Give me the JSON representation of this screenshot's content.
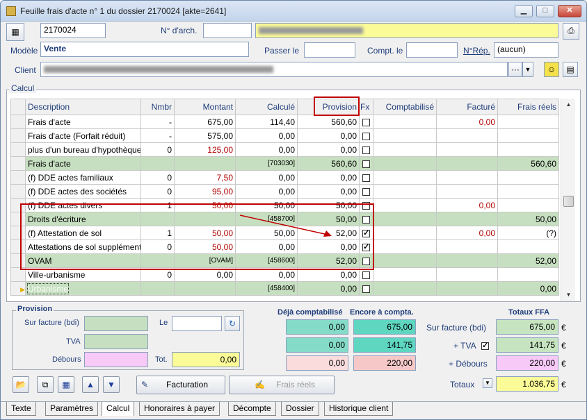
{
  "window": {
    "title": "Feuille frais d'acte n° 1 du dossier 2170024 [akte=2641]"
  },
  "header": {
    "dossier_value": "2170024",
    "narch_label": "N° d'arch.",
    "narch_value": "",
    "modele_label": "Modèle",
    "modele_value": "Vente",
    "passer_label": "Passer le",
    "passer_value": "",
    "compt_label": "Compt. le",
    "compt_value": "",
    "nrep_label": "N°Rép.",
    "nrep_value": "(aucun)",
    "client_label": "Client",
    "ellipsis": "···"
  },
  "calc": {
    "group_label": "Calcul",
    "columns": [
      "Description",
      "Nmbr",
      "Montant",
      "Calculé",
      "Provision",
      "Fx",
      "Comptabilisé",
      "Facturé",
      "Frais réels"
    ],
    "rows": [
      {
        "type": "item",
        "desc": "Frais d'acte",
        "nmbr": "-",
        "montant": "675,00",
        "calcule": "114,40",
        "provision": "560,60",
        "fx": false,
        "compt": "",
        "facture": "0,00",
        "frais": "",
        "montant_red": false,
        "facture_red": true
      },
      {
        "type": "item",
        "desc": "Frais d'acte (Forfait réduit)",
        "nmbr": "-",
        "montant": "575,00",
        "calcule": "0,00",
        "provision": "0,00",
        "fx": false,
        "compt": "",
        "facture": "",
        "frais": "",
        "montant_red": false
      },
      {
        "type": "item",
        "desc": "plus d'un bureau d'hypothèques",
        "nmbr": "0",
        "montant": "125,00",
        "calcule": "0,00",
        "provision": "0,00",
        "fx": false,
        "compt": "",
        "facture": "",
        "frais": "",
        "montant_red": true
      },
      {
        "type": "sub",
        "desc": "Frais d'acte",
        "nmbr": "",
        "montant": "",
        "calcule": "[703030]",
        "provision": "560,60",
        "fx": false,
        "compt": "",
        "facture": "",
        "frais": "560,60"
      },
      {
        "type": "item",
        "desc": "(f) DDE actes familiaux",
        "nmbr": "0",
        "montant": "7,50",
        "calcule": "0,00",
        "provision": "0,00",
        "fx": false,
        "compt": "",
        "facture": "",
        "frais": "",
        "montant_red": true
      },
      {
        "type": "item",
        "desc": "(f) DDE actes des sociétés",
        "nmbr": "0",
        "montant": "95,00",
        "calcule": "0,00",
        "provision": "0,00",
        "fx": false,
        "compt": "",
        "facture": "",
        "frais": "",
        "montant_red": true
      },
      {
        "type": "item",
        "desc": "(f) DDE actes divers",
        "nmbr": "1",
        "montant": "50,00",
        "calcule": "50,00",
        "provision": "50,00",
        "fx": false,
        "compt": "",
        "facture": "0,00",
        "frais": "",
        "montant_red": true,
        "facture_red": true
      },
      {
        "type": "sub",
        "desc": "Droits d'écriture",
        "nmbr": "",
        "montant": "",
        "calcule": "[458700]",
        "provision": "50,00",
        "fx": false,
        "compt": "",
        "facture": "",
        "frais": "50,00"
      },
      {
        "type": "item",
        "desc": "(f) Attestation de sol",
        "nmbr": "1",
        "montant": "50,00",
        "calcule": "50,00",
        "provision": "52,00",
        "fx": true,
        "compt": "",
        "facture": "0,00",
        "frais": "(?)",
        "montant_red": true,
        "facture_red": true
      },
      {
        "type": "item",
        "desc": "Attestations de sol supplémentaires",
        "nmbr": "0",
        "montant": "50,00",
        "calcule": "0,00",
        "provision": "0,00",
        "fx": true,
        "compt": "",
        "facture": "",
        "frais": "",
        "montant_red": true
      },
      {
        "type": "sub",
        "desc": "OVAM",
        "nmbr": "",
        "montant": "[OVAM]",
        "calcule": "[458600]",
        "provision": "52,00",
        "fx": false,
        "compt": "",
        "facture": "",
        "frais": "52,00"
      },
      {
        "type": "item",
        "desc": "Ville-urbanisme",
        "nmbr": "0",
        "montant": "0,00",
        "calcule": "0,00",
        "provision": "0,00",
        "fx": false,
        "compt": "",
        "facture": "",
        "frais": "",
        "montant_red": false
      },
      {
        "type": "sub",
        "desc": "Urbanisme",
        "nmbr": "",
        "montant": "",
        "calcule": "[458400]",
        "provision": "0,00",
        "fx": false,
        "compt": "",
        "facture": "",
        "frais": "0,00",
        "selected": true
      }
    ]
  },
  "provision": {
    "group_label": "Provision",
    "sur_facture_label": "Sur facture (bdi)",
    "tva_label": "TVA",
    "debours_label": "Débours",
    "le_label": "Le",
    "tot_label": "Tot.",
    "tot_value": "0,00"
  },
  "compta": {
    "deja_label": "Déjà comptabilisé",
    "encore_label": "Encore à compta.",
    "totaux_label": "Totaux FFA",
    "deja": [
      "0,00",
      "0,00",
      "0,00"
    ],
    "encore": [
      "675,00",
      "141,75",
      "220,00"
    ],
    "sur_facture_label": "Sur facture (bdi)",
    "tva_label": "+ TVA",
    "debours_label": "+ Débours",
    "totaux_row_label": "Totaux",
    "totaux": [
      "675,00",
      "141,75",
      "220,00",
      "1.036,75"
    ],
    "currency": "€"
  },
  "toolbar": {
    "facturation_label": "Facturation",
    "frais_reels_label": "Frais réels"
  },
  "tabs": [
    "Texte",
    "Paramètres",
    "Calcul",
    "Honoraires à payer",
    "Décompte",
    "Dossier",
    "Historique client"
  ]
}
